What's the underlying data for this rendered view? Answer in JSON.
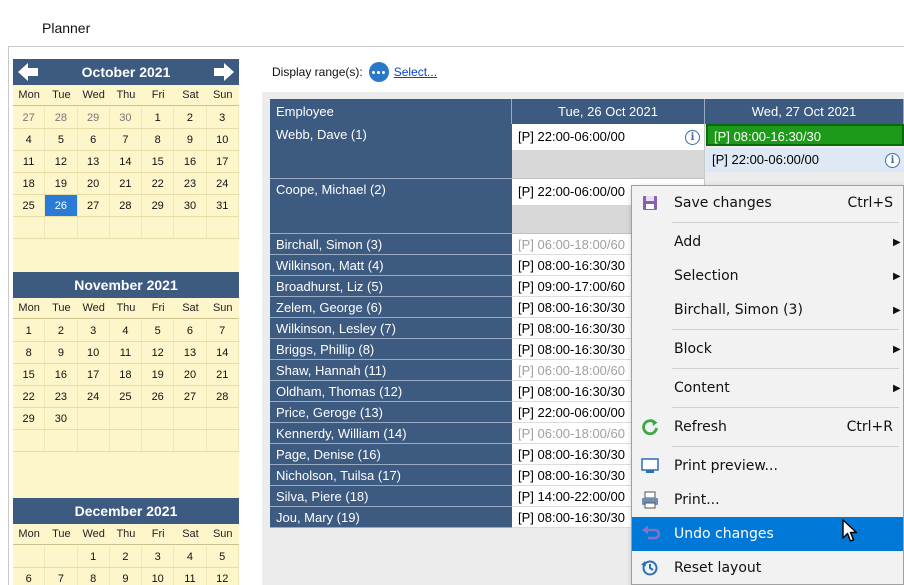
{
  "window": {
    "title": "Planner"
  },
  "calendar": {
    "months": [
      {
        "name": "October 2021",
        "nav": true,
        "dow": [
          "Mon",
          "Tue",
          "Wed",
          "Thu",
          "Fri",
          "Sat",
          "Sun"
        ],
        "weeks": [
          [
            "27",
            "28",
            "29",
            "30",
            "1",
            "2",
            "3"
          ],
          [
            "4",
            "5",
            "6",
            "7",
            "8",
            "9",
            "10"
          ],
          [
            "11",
            "12",
            "13",
            "14",
            "15",
            "16",
            "17"
          ],
          [
            "18",
            "19",
            "20",
            "21",
            "22",
            "23",
            "24"
          ],
          [
            "25",
            "26",
            "27",
            "28",
            "29",
            "30",
            "31"
          ],
          [
            "",
            "",
            "",
            "",
            "",
            "",
            ""
          ]
        ],
        "selected": "26"
      },
      {
        "name": "November 2021",
        "dow": [
          "Mon",
          "Tue",
          "Wed",
          "Thu",
          "Fri",
          "Sat",
          "Sun"
        ],
        "weeks": [
          [
            "1",
            "2",
            "3",
            "4",
            "5",
            "6",
            "7"
          ],
          [
            "8",
            "9",
            "10",
            "11",
            "12",
            "13",
            "14"
          ],
          [
            "15",
            "16",
            "17",
            "18",
            "19",
            "20",
            "21"
          ],
          [
            "22",
            "23",
            "24",
            "25",
            "26",
            "27",
            "28"
          ],
          [
            "29",
            "30",
            "",
            "",
            "",
            "",
            ""
          ],
          [
            "",
            "",
            "",
            "",
            "",
            "",
            ""
          ]
        ]
      },
      {
        "name": "December 2021",
        "dow": [
          "Mon",
          "Tue",
          "Wed",
          "Thu",
          "Fri",
          "Sat",
          "Sun"
        ],
        "weeks": [
          [
            "",
            "",
            "1",
            "2",
            "3",
            "4",
            "5"
          ],
          [
            "6",
            "7",
            "8",
            "9",
            "10",
            "11",
            "12"
          ]
        ]
      }
    ]
  },
  "range": {
    "label": "Display range(s):",
    "link": "Select..."
  },
  "table": {
    "headers": {
      "employee": "Employee",
      "day1": "Tue, 26 Oct 2021",
      "day2": "Wed, 27 Oct 2021"
    },
    "rows": [
      {
        "name": "Webb, Dave (1)",
        "shift": "[P] 22:00-06:00/00",
        "tall": true,
        "info": true
      },
      {
        "name": "Coope, Michael (2)",
        "shift": "[P] 22:00-06:00/00",
        "tall": true
      },
      {
        "name": "Birchall, Simon (3)",
        "shift": "[P] 06:00-18:00/60",
        "muted": true
      },
      {
        "name": "Wilkinson, Matt (4)",
        "shift": "[P] 08:00-16:30/30"
      },
      {
        "name": "Broadhurst, Liz (5)",
        "shift": "[P] 09:00-17:00/60"
      },
      {
        "name": "Zelem, George (6)",
        "shift": "[P] 08:00-16:30/30"
      },
      {
        "name": "Wilkinson, Lesley (7)",
        "shift": "[P] 08:00-16:30/30"
      },
      {
        "name": "Briggs, Phillip (8)",
        "shift": "[P] 08:00-16:30/30"
      },
      {
        "name": "Shaw, Hannah (11)",
        "shift": "[P] 06:00-18:00/60",
        "muted": true
      },
      {
        "name": "Oldham, Thomas (12)",
        "shift": "[P] 08:00-16:30/30"
      },
      {
        "name": "Price, Geroge (13)",
        "shift": "[P] 22:00-06:00/00"
      },
      {
        "name": "Kennerdy, William (14)",
        "shift": "[P] 06:00-18:00/60",
        "muted": true
      },
      {
        "name": "Page, Denise (16)",
        "shift": "[P] 08:00-16:30/30"
      },
      {
        "name": "Nicholson, Tuilsa (17)",
        "shift": "[P] 08:00-16:30/30"
      },
      {
        "name": "Silva, Piere (18)",
        "shift": "[P] 14:00-22:00/00"
      },
      {
        "name": "Jou, Mary (19)",
        "shift": "[P] 08:00-16:30/30"
      }
    ],
    "day2": {
      "green": "[P] 08:00-16:30/30",
      "second": "[P] 22:00-06:00/00",
      "row2": "[P] 22:00-06:00/00"
    }
  },
  "context_menu": {
    "items": [
      {
        "id": "save",
        "label": "Save changes",
        "shortcut": "Ctrl+S",
        "icon": "save-icon"
      },
      {
        "sep": true
      },
      {
        "id": "add",
        "label": "Add",
        "submenu": true
      },
      {
        "id": "selection",
        "label": "Selection",
        "submenu": true
      },
      {
        "id": "birchall",
        "label": "Birchall, Simon (3)",
        "submenu": true
      },
      {
        "sep": true
      },
      {
        "id": "block",
        "label": "Block",
        "submenu": true
      },
      {
        "sep": true
      },
      {
        "id": "content",
        "label": "Content",
        "submenu": true
      },
      {
        "sep": true
      },
      {
        "id": "refresh",
        "label": "Refresh",
        "shortcut": "Ctrl+R",
        "icon": "refresh-icon"
      },
      {
        "sep": true
      },
      {
        "id": "preview",
        "label": "Print preview...",
        "icon": "print-preview-icon"
      },
      {
        "id": "print",
        "label": "Print...",
        "icon": "printer-icon"
      },
      {
        "id": "undo",
        "label": "Undo changes",
        "icon": "undo-icon",
        "highlight": true
      },
      {
        "id": "reset",
        "label": "Reset layout",
        "icon": "reset-icon"
      }
    ]
  },
  "colors": {
    "header": "#3d5a80",
    "calendar_bg": "#fdf6cb",
    "selected_day": "#2a7bd6",
    "green_shift": "#1d9a1a",
    "menu_highlight": "#0078d7"
  }
}
